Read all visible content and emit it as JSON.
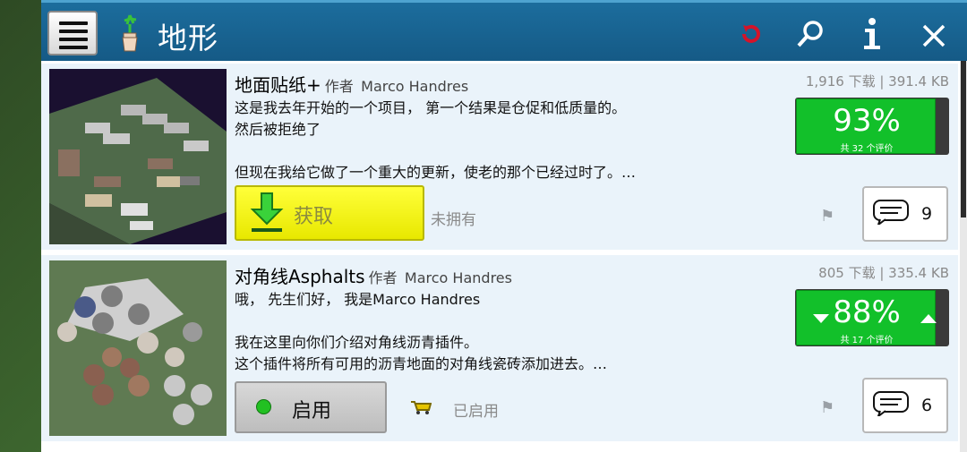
{
  "header": {
    "title": "地形",
    "icons": [
      "menu-icon",
      "potted-plant-icon",
      "refresh-icon",
      "search-icon",
      "info-icon",
      "close-icon"
    ]
  },
  "mods": [
    {
      "name": "地面贴纸+",
      "author_prefix": "作者",
      "author": "Marco Handres",
      "stats": "1,916 下载 | 391.4 KB",
      "description": "这是我去年开始的一个项目， 第一个结果是仓促和低质量的。\n然后被拒绝了\n\n但现在我给它做了一个重大的更新，使老的那个已经过时了。…",
      "rating_percent": "93%",
      "rating_count": "共 32 个评价",
      "action_label": "获取",
      "status_label": "未拥有",
      "comments": "9"
    },
    {
      "name": "对角线Asphalts",
      "author_prefix": "作者",
      "author": "Marco Handres",
      "stats": "805 下载 | 335.4 KB",
      "description": "哦， 先生们好， 我是Marco Handres\n\n我在这里向你们介绍对角线沥青插件。\n这个插件将所有可用的沥青地面的对角线瓷砖添加进去。…",
      "rating_percent": "88%",
      "rating_count": "共 17 个评价",
      "action_label": "启用",
      "status_label": "已启用",
      "comments": "6"
    }
  ],
  "colors": {
    "header_bg": "#1a6894",
    "rating_green": "#12c02a",
    "get_button_yellow": "#ffff3a",
    "item_bg": "#eaf3fa"
  }
}
